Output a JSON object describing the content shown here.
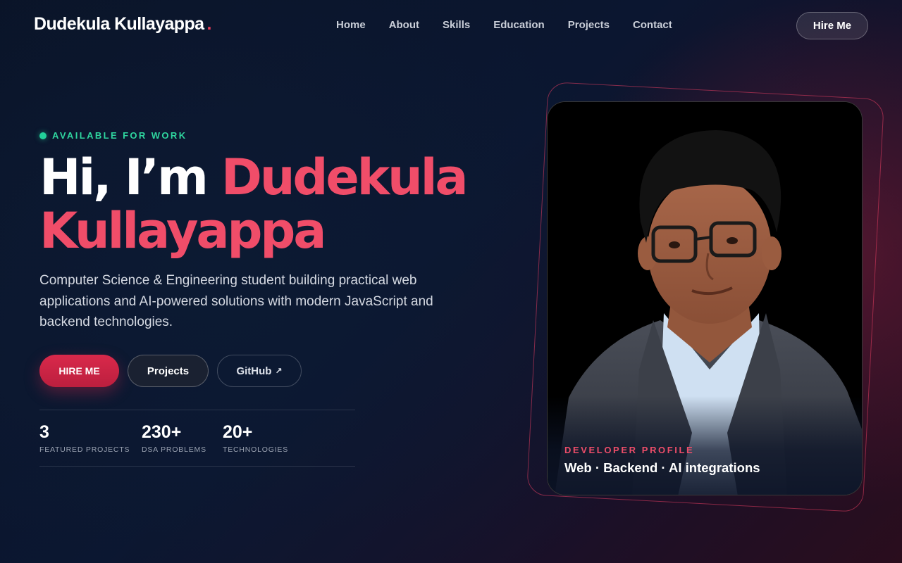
{
  "brand": {
    "name": "Dudekula Kullayappa",
    "dot": "."
  },
  "nav": {
    "links": [
      "Home",
      "About",
      "Skills",
      "Education",
      "Projects",
      "Contact"
    ],
    "cta": "Hire Me"
  },
  "hero": {
    "status": "AVAILABLE FOR WORK",
    "greeting": "Hi, I’m",
    "name_first": "Dudekula",
    "name_last": "Kullayappa",
    "description": "Computer Science & Engineering student building practical web applications and AI-powered solutions with modern JavaScript and backend technologies.",
    "buttons": {
      "primary": "HIRE ME",
      "secondary": "Projects",
      "github": "GitHub",
      "github_icon": "↗"
    },
    "stats": [
      {
        "value": "3",
        "label": "FEATURED PROJECTS"
      },
      {
        "value": "230+",
        "label": "DSA PROBLEMS"
      },
      {
        "value": "20+",
        "label": "TECHNOLOGIES"
      }
    ]
  },
  "profile_card": {
    "kicker": "DEVELOPER PROFILE",
    "title": "Web · Backend · AI integrations"
  },
  "colors": {
    "accent": "#f04d69",
    "status_green": "#22d19a",
    "background": "#0b1630"
  }
}
